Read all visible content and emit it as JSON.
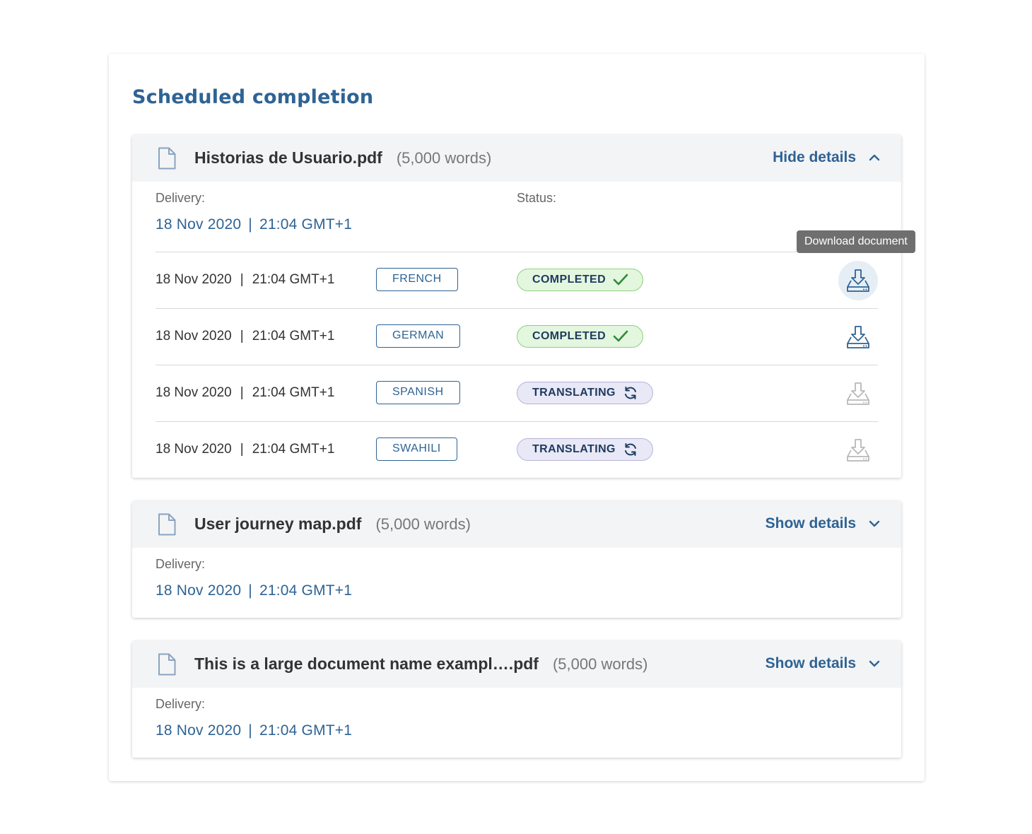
{
  "page": {
    "title": "Scheduled completion"
  },
  "tooltip": {
    "text": "Download document"
  },
  "documents": [
    {
      "name": "Historias de Usuario.pdf",
      "words": "(5,000 words)",
      "toggle_label": "Hide details",
      "delivery_label": "Delivery:",
      "delivery_date": "18 Nov 2020",
      "delivery_time": "21:04 GMT+1",
      "status_label": "Status:",
      "languages": [
        {
          "date": "18 Nov 2020",
          "time": "21:04 GMT+1",
          "language": "FRENCH",
          "status": "COMPLETED",
          "download_enabled": true
        },
        {
          "date": "18 Nov 2020",
          "time": "21:04 GMT+1",
          "language": "GERMAN",
          "status": "COMPLETED",
          "download_enabled": true
        },
        {
          "date": "18 Nov 2020",
          "time": "21:04 GMT+1",
          "language": "SPANISH",
          "status": "TRANSLATING",
          "download_enabled": false
        },
        {
          "date": "18 Nov 2020",
          "time": "21:04 GMT+1",
          "language": "SWAHILI",
          "status": "TRANSLATING",
          "download_enabled": false
        }
      ]
    },
    {
      "name": "User journey map.pdf",
      "words": "(5,000 words)",
      "toggle_label": "Show details",
      "delivery_label": "Delivery:",
      "delivery_date": "18 Nov 2020",
      "delivery_time": "21:04 GMT+1"
    },
    {
      "name": "This is a large document name exampl….pdf",
      "words": "(5,000 words)",
      "toggle_label": "Show details",
      "delivery_label": "Delivery:",
      "delivery_date": "18 Nov 2020",
      "delivery_time": "21:04 GMT+1"
    }
  ],
  "separator": "|",
  "icons": {
    "file": "file-icon",
    "chevron_up": "chevron-up-icon",
    "chevron_down": "chevron-down-icon",
    "download": "download-tray-icon",
    "check": "check-icon",
    "sync": "sync-icon"
  },
  "colors": {
    "accent": "#2e6394",
    "completed_bg": "#e3f6de",
    "completed_border": "#8fd07e",
    "check": "#2f8a3a",
    "translating_bg": "#e8e8f6",
    "translating_border": "#b7b4d8",
    "download_disabled": "#b8b8b8",
    "tooltip_bg": "#6f6f6f"
  }
}
